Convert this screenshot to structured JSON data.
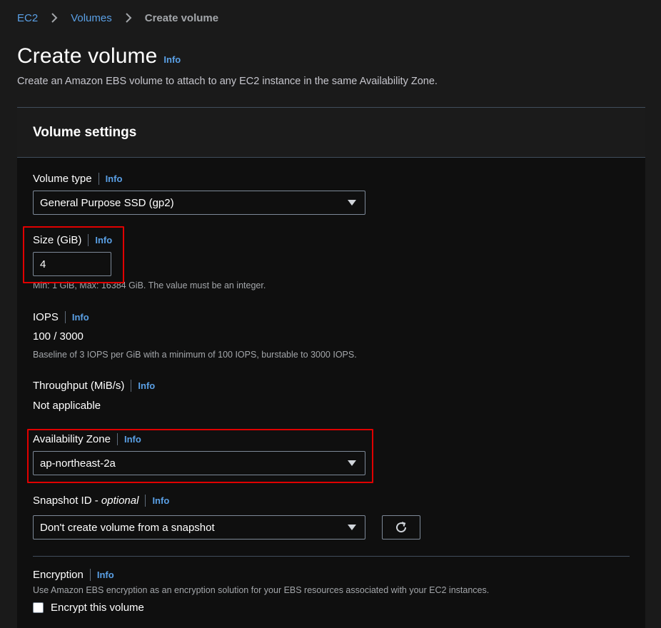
{
  "breadcrumb": {
    "items": [
      "EC2",
      "Volumes"
    ],
    "current": "Create volume"
  },
  "page": {
    "title": "Create volume",
    "info": "Info",
    "description": "Create an Amazon EBS volume to attach to any EC2 instance in the same Availability Zone."
  },
  "panel": {
    "title": "Volume settings"
  },
  "volume_type": {
    "label": "Volume type",
    "info": "Info",
    "value": "General Purpose SSD (gp2)"
  },
  "size": {
    "label": "Size (GiB)",
    "info": "Info",
    "value": "4",
    "hint": "Min: 1 GiB, Max: 16384 GiB. The value must be an integer."
  },
  "iops": {
    "label": "IOPS",
    "info": "Info",
    "value": "100 / 3000",
    "hint": "Baseline of 3 IOPS per GiB with a minimum of 100 IOPS, burstable to 3000 IOPS."
  },
  "throughput": {
    "label": "Throughput (MiB/s)",
    "info": "Info",
    "value": "Not applicable"
  },
  "availability_zone": {
    "label": "Availability Zone",
    "info": "Info",
    "value": "ap-northeast-2a"
  },
  "snapshot": {
    "label": "Snapshot ID - ",
    "label_optional": "optional",
    "info": "Info",
    "value": "Don't create volume from a snapshot"
  },
  "encryption": {
    "label": "Encryption",
    "info": "Info",
    "hint": "Use Amazon EBS encryption as an encryption solution for your EBS resources associated with your EC2 instances.",
    "checkbox_label": "Encrypt this volume"
  },
  "colors": {
    "link": "#5aa0e6",
    "highlight": "#e00000",
    "background": "#0f0f0f"
  }
}
